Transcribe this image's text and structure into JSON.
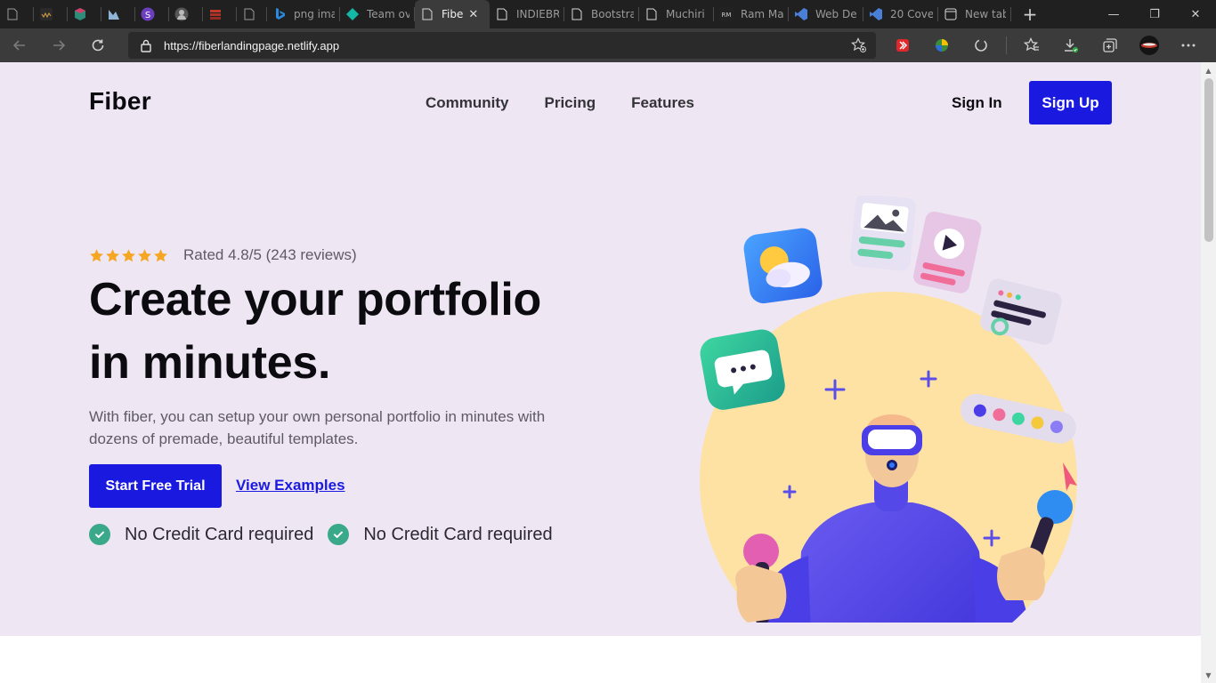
{
  "browser": {
    "tabs": [
      {
        "title": "",
        "icon": "blank-page-icon",
        "active": false
      },
      {
        "title": "",
        "icon": "site-wm-icon",
        "active": false
      },
      {
        "title": "",
        "icon": "cube-icon",
        "active": false
      },
      {
        "title": "",
        "icon": "mountain-icon",
        "active": false
      },
      {
        "title": "",
        "icon": "s-circle-icon",
        "active": false
      },
      {
        "title": "",
        "icon": "avatar-icon",
        "active": false
      },
      {
        "title": "",
        "icon": "stack-icon",
        "active": false
      },
      {
        "title": "",
        "icon": "blank-page-icon",
        "active": false
      },
      {
        "title": "png ima",
        "icon": "bing-icon",
        "active": false
      },
      {
        "title": "Team ov",
        "icon": "diamond-icon",
        "active": false
      },
      {
        "title": "Fibe",
        "icon": "page-icon",
        "active": true
      },
      {
        "title": "INDIEBR",
        "icon": "page-icon",
        "active": false
      },
      {
        "title": "Bootstra",
        "icon": "page-icon",
        "active": false
      },
      {
        "title": "Muchiri",
        "icon": "page-icon",
        "active": false
      },
      {
        "title": "Ram Ma",
        "icon": "rm-icon",
        "active": false
      },
      {
        "title": "Web De",
        "icon": "visual-studio-icon",
        "active": false
      },
      {
        "title": "20 Cove",
        "icon": "visual-studio-icon",
        "active": false
      },
      {
        "title": "New tab",
        "icon": "newtab-page-icon",
        "active": false
      }
    ],
    "new_tab_glyph": "+",
    "window_controls": {
      "minimize": "—",
      "restore": "❐",
      "close": "✕"
    },
    "url": "https://fiberlandingpage.netlify.app"
  },
  "page": {
    "logo": "Fiber",
    "nav": [
      "Community",
      "Pricing",
      "Features"
    ],
    "sign_in": "Sign In",
    "sign_up": "Sign Up",
    "rating": {
      "stars": 5,
      "text": "Rated 4.8/5 (243 reviews)"
    },
    "headline_line1": "Create your portfolio",
    "headline_line2": "in minutes.",
    "subtext": "With fiber, you can setup your own personal portfolio in minutes with dozens of premade, beautiful templates.",
    "primary_cta": "Start Free Trial",
    "secondary_cta": "View Examples",
    "checks": [
      "No Credit Card required",
      "No Credit Card required"
    ],
    "colors": {
      "accent": "#1919e0",
      "hero_bg": "#efe6f3",
      "check": "#3aa98a",
      "star": "#f5a623"
    }
  }
}
